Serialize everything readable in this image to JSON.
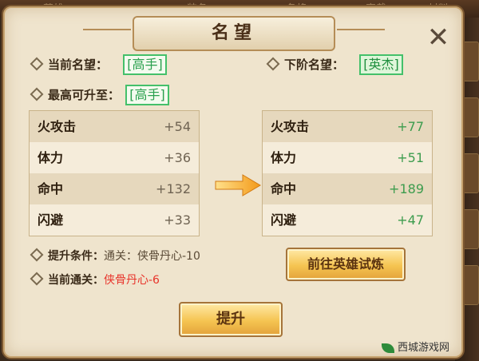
{
  "dialog": {
    "title": "名望"
  },
  "current": {
    "label": "当前名望：",
    "value": "[高手]"
  },
  "next": {
    "label": "下阶名望：",
    "value": "[英杰]"
  },
  "max": {
    "label": "最高可升至：",
    "value": "[高手]"
  },
  "current_stats": [
    {
      "name": "火攻击",
      "value": "+54"
    },
    {
      "name": "体力",
      "value": "+36"
    },
    {
      "name": "命中",
      "value": "+132"
    },
    {
      "name": "闪避",
      "value": "+33"
    }
  ],
  "next_stats": [
    {
      "name": "火攻击",
      "value": "+77"
    },
    {
      "name": "体力",
      "value": "+51"
    },
    {
      "name": "命中",
      "value": "+189"
    },
    {
      "name": "闪避",
      "value": "+47"
    }
  ],
  "condition": {
    "label": "提升条件：",
    "value": "通关：侠骨丹心-10"
  },
  "progress": {
    "label": "当前通关：",
    "value": "侠骨丹心-6"
  },
  "buttons": {
    "trial": "前往英雄试炼",
    "upgrade": "提升"
  },
  "background": {
    "labels": [
      "英雄",
      "装备",
      "名将",
      "穿戴",
      "材料"
    ]
  },
  "watermark": "西城游戏网",
  "colors": {
    "rank_border": "#44c06a",
    "stat_up": "#3d9c4e",
    "warning": "#e8332a",
    "button": "#f5c451"
  }
}
